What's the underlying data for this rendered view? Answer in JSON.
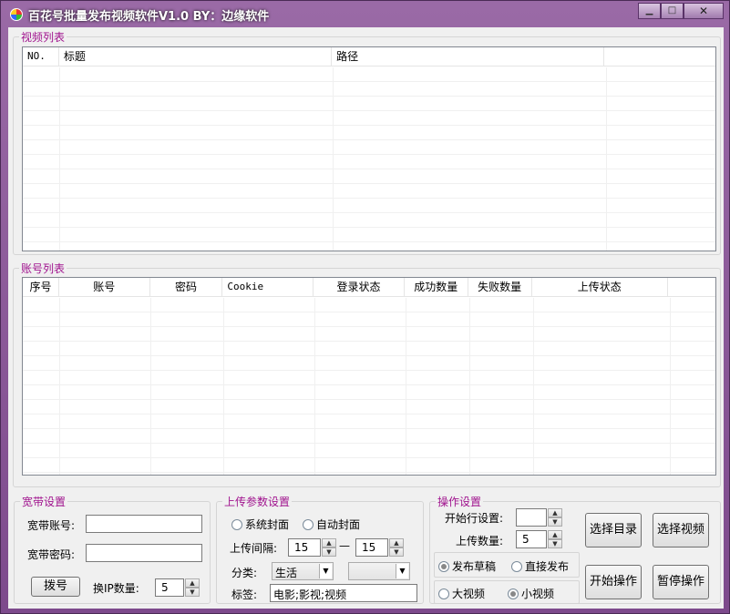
{
  "window": {
    "title": "百花号批量发布视频软件V1.0 BY：边缘软件",
    "minimize": "▁",
    "maximize": "□",
    "close": "✕",
    "icon": "app-icon"
  },
  "video_list": {
    "label": "视频列表",
    "columns": [
      "NO.",
      "标题",
      "路径",
      ""
    ],
    "rows": []
  },
  "account_list": {
    "label": "账号列表",
    "columns": [
      "序号",
      "账号",
      "密码",
      "Cookie",
      "登录状态",
      "成功数量",
      "失败数量",
      "上传状态",
      ""
    ],
    "rows": []
  },
  "broadband": {
    "label": "宽带设置",
    "account_label": "宽带账号:",
    "account_value": "",
    "password_label": "宽带密码:",
    "password_value": "",
    "dial_button": "拨号",
    "ip_count_label": "换IP数量:",
    "ip_count_value": "5"
  },
  "upload": {
    "label": "上传参数设置",
    "cover_system": "系统封面",
    "cover_auto": "自动封面",
    "interval_label": "上传间隔:",
    "interval_from": "15",
    "interval_sep": "—",
    "interval_to": "15",
    "category_label": "分类:",
    "category_value": "生活",
    "subcategory_value": "",
    "tags_label": "标签:",
    "tags_value": "电影;影视;视频"
  },
  "operation": {
    "label": "操作设置",
    "start_row_label": "开始行设置:",
    "start_row_value": "",
    "upload_count_label": "上传数量:",
    "upload_count_value": "5",
    "draft": "发布草稿",
    "direct": "直接发布",
    "big_video": "大视频",
    "small_video": "小视频",
    "publish_mode_selected": "draft",
    "video_size_selected": "small"
  },
  "buttons": {
    "select_dir": "选择目录",
    "select_video": "选择视频",
    "start": "开始操作",
    "pause": "暂停操作"
  },
  "spin_arrows": {
    "up": "▲",
    "down": "▼"
  },
  "combo_arrow": "▼"
}
